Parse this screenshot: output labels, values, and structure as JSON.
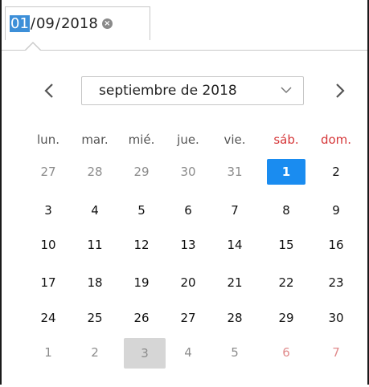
{
  "input": {
    "day": "01",
    "sep1": "/",
    "month": "09",
    "sep2": "/",
    "year": "2018",
    "clear_icon": "×"
  },
  "header": {
    "prev_label": "‹",
    "month_year": "septiembre de 2018",
    "next_label": "›"
  },
  "weekdays": [
    "lun.",
    "mar.",
    "mié.",
    "jue.",
    "vie.",
    "sáb.",
    "dom."
  ],
  "weeks": [
    [
      "27",
      "28",
      "29",
      "30",
      "31",
      "1",
      "2"
    ],
    [
      "3",
      "4",
      "5",
      "6",
      "7",
      "8",
      "9"
    ],
    [
      "10",
      "11",
      "12",
      "13",
      "14",
      "15",
      "16"
    ],
    [
      "17",
      "18",
      "19",
      "20",
      "21",
      "22",
      "23"
    ],
    [
      "24",
      "25",
      "26",
      "27",
      "28",
      "29",
      "30"
    ],
    [
      "1",
      "2",
      "3",
      "4",
      "5",
      "6",
      "7"
    ]
  ],
  "colors": {
    "selected": "#1a8cf0",
    "weekend": "#d6383a",
    "today_bg": "#d6d6d6",
    "input_highlight": "#3d8fd8"
  },
  "icons": {
    "prev": "chevron-left-icon",
    "next": "chevron-right-icon",
    "dropdown": "chevron-down-icon",
    "clear": "clear-icon"
  }
}
